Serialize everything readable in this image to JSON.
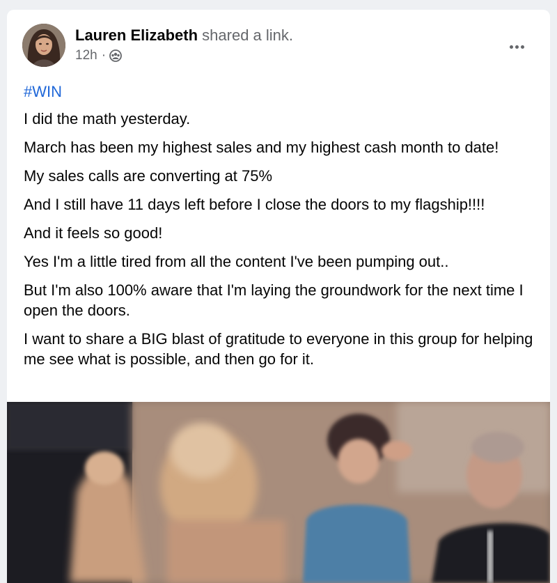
{
  "post": {
    "author_name": "Lauren Elizabeth",
    "action": "shared a link.",
    "timestamp": "12h",
    "separator": "·",
    "privacy_icon": "group-icon",
    "more_icon": "more-horizontal-icon",
    "hashtag": "#WIN",
    "paragraphs": [
      "I did the math yesterday.",
      "March has been my highest sales and my highest cash month to date!",
      "My sales calls are converting at 75%",
      "And I still have 11 days left before I close the doors to my flagship!!!!",
      "And it feels so good!",
      "Yes I'm a little tired from all the content I've been pumping out..",
      "But I'm also 100% aware that I'm laying the groundwork for the next time I open the doors.",
      "I want to share a BIG blast of gratitude to everyone in this group for helping me see what is possible, and then go for it."
    ]
  },
  "colors": {
    "page_background": "#eef0f3",
    "card_background": "#ffffff",
    "hashtag_link": "#1f67d8",
    "secondary_text": "#65676b",
    "primary_text": "#050505"
  }
}
